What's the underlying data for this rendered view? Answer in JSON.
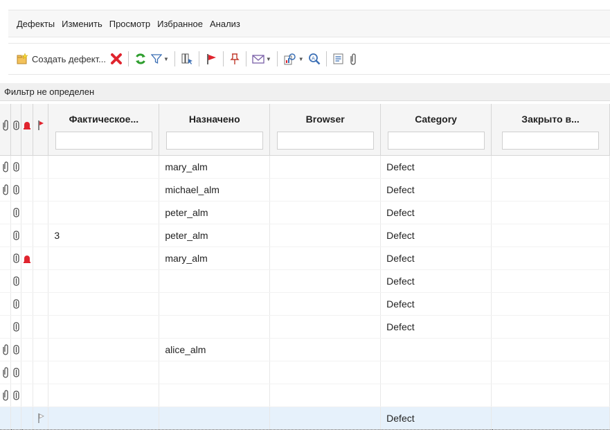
{
  "menu": [
    "Дефекты",
    "Изменить",
    "Просмотр",
    "Избранное",
    "Анализ"
  ],
  "toolbar": {
    "create_label": "Создать дефект..."
  },
  "filter_status": "Фильтр не определен",
  "columns": [
    "Фактическое...",
    "Назначено",
    "Browser",
    "Category",
    "Закрыто в..."
  ],
  "colors": {
    "accent_red": "#e0242e",
    "refresh_green": "#2e9e2e",
    "selected_row": "#e6f1fb"
  },
  "rows": [
    {
      "attach": true,
      "linked": true,
      "alert": false,
      "flag": false,
      "actual": "",
      "assigned": "mary_alm",
      "browser": "",
      "category": "Defect",
      "closed": ""
    },
    {
      "attach": true,
      "linked": true,
      "alert": false,
      "flag": false,
      "actual": "",
      "assigned": "michael_alm",
      "browser": "",
      "category": "Defect",
      "closed": ""
    },
    {
      "attach": false,
      "linked": true,
      "alert": false,
      "flag": false,
      "actual": "",
      "assigned": "peter_alm",
      "browser": "",
      "category": "Defect",
      "closed": ""
    },
    {
      "attach": false,
      "linked": true,
      "alert": false,
      "flag": false,
      "actual": "3",
      "assigned": "peter_alm",
      "browser": "",
      "category": "Defect",
      "closed": ""
    },
    {
      "attach": false,
      "linked": true,
      "alert": true,
      "flag": false,
      "actual": "",
      "assigned": "mary_alm",
      "browser": "",
      "category": "Defect",
      "closed": ""
    },
    {
      "attach": false,
      "linked": true,
      "alert": false,
      "flag": false,
      "actual": "",
      "assigned": "",
      "browser": "",
      "category": "Defect",
      "closed": ""
    },
    {
      "attach": false,
      "linked": true,
      "alert": false,
      "flag": false,
      "actual": "",
      "assigned": "",
      "browser": "",
      "category": "Defect",
      "closed": ""
    },
    {
      "attach": false,
      "linked": true,
      "alert": false,
      "flag": false,
      "actual": "",
      "assigned": "",
      "browser": "",
      "category": "Defect",
      "closed": ""
    },
    {
      "attach": true,
      "linked": true,
      "alert": false,
      "flag": false,
      "actual": "",
      "assigned": "alice_alm",
      "browser": "",
      "category": "",
      "closed": ""
    },
    {
      "attach": true,
      "linked": true,
      "alert": false,
      "flag": false,
      "actual": "",
      "assigned": "",
      "browser": "",
      "category": "",
      "closed": ""
    },
    {
      "attach": true,
      "linked": true,
      "alert": false,
      "flag": false,
      "actual": "",
      "assigned": "",
      "browser": "",
      "category": "",
      "closed": ""
    },
    {
      "attach": false,
      "linked": false,
      "alert": false,
      "flag": true,
      "actual": "",
      "assigned": "",
      "browser": "",
      "category": "Defect",
      "closed": "",
      "selected": true
    }
  ]
}
